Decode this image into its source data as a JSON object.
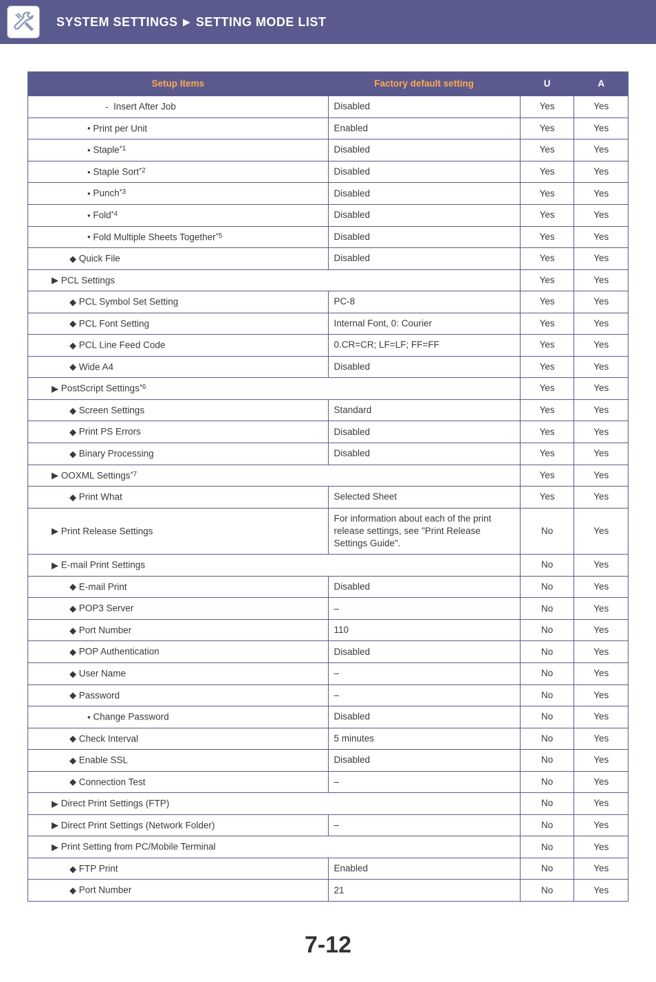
{
  "header": {
    "title_left": "SYSTEM SETTINGS",
    "title_right": "SETTING MODE LIST"
  },
  "columns": {
    "setup": "Setup Items",
    "factory": "Factory default setting",
    "u": "U",
    "a": "A"
  },
  "rows": [
    {
      "indent": 4,
      "marker": "dash",
      "label": "Insert After Job",
      "factory": "Disabled",
      "u": "Yes",
      "a": "Yes"
    },
    {
      "indent": 3,
      "marker": "bullet",
      "label": "Print per Unit",
      "factory": "Enabled",
      "u": "Yes",
      "a": "Yes"
    },
    {
      "indent": 3,
      "marker": "bullet",
      "label": "Staple",
      "sup": "*1",
      "factory": "Disabled",
      "u": "Yes",
      "a": "Yes"
    },
    {
      "indent": 3,
      "marker": "bullet",
      "label": "Staple Sort",
      "sup": "*2",
      "factory": "Disabled",
      "u": "Yes",
      "a": "Yes"
    },
    {
      "indent": 3,
      "marker": "bullet",
      "label": "Punch",
      "sup": "*3",
      "factory": "Disabled",
      "u": "Yes",
      "a": "Yes"
    },
    {
      "indent": 3,
      "marker": "bullet",
      "label": "Fold",
      "sup": "*4",
      "factory": "Disabled",
      "u": "Yes",
      "a": "Yes"
    },
    {
      "indent": 3,
      "marker": "bullet",
      "label": "Fold Multiple Sheets Together",
      "sup": "*5",
      "factory": "Disabled",
      "u": "Yes",
      "a": "Yes"
    },
    {
      "indent": 2,
      "marker": "diamond",
      "label": "Quick File",
      "factory": "Disabled",
      "u": "Yes",
      "a": "Yes"
    },
    {
      "indent": 1,
      "marker": "tri",
      "label": "PCL Settings",
      "factory": "",
      "span": true,
      "u": "Yes",
      "a": "Yes"
    },
    {
      "indent": 2,
      "marker": "diamond",
      "label": "PCL Symbol Set Setting",
      "factory": "PC-8",
      "u": "Yes",
      "a": "Yes"
    },
    {
      "indent": 2,
      "marker": "diamond",
      "label": "PCL Font Setting",
      "factory": "Internal Font, 0: Courier",
      "u": "Yes",
      "a": "Yes"
    },
    {
      "indent": 2,
      "marker": "diamond",
      "label": "PCL Line Feed Code",
      "factory": "0.CR=CR; LF=LF; FF=FF",
      "u": "Yes",
      "a": "Yes"
    },
    {
      "indent": 2,
      "marker": "diamond",
      "label": "Wide A4",
      "factory": "Disabled",
      "u": "Yes",
      "a": "Yes"
    },
    {
      "indent": 1,
      "marker": "tri",
      "label": "PostScript Settings",
      "sup": "*6",
      "factory": "",
      "span": true,
      "u": "Yes",
      "a": "Yes"
    },
    {
      "indent": 2,
      "marker": "diamond",
      "label": "Screen Settings",
      "factory": "Standard",
      "u": "Yes",
      "a": "Yes"
    },
    {
      "indent": 2,
      "marker": "diamond",
      "label": "Print PS Errors",
      "factory": "Disabled",
      "u": "Yes",
      "a": "Yes"
    },
    {
      "indent": 2,
      "marker": "diamond",
      "label": "Binary Processing",
      "factory": "Disabled",
      "u": "Yes",
      "a": "Yes"
    },
    {
      "indent": 1,
      "marker": "tri",
      "label": "OOXML Settings",
      "sup": "*7",
      "factory": "",
      "span": true,
      "u": "Yes",
      "a": "Yes"
    },
    {
      "indent": 2,
      "marker": "diamond",
      "label": "Print What",
      "factory": "Selected Sheet",
      "u": "Yes",
      "a": "Yes"
    },
    {
      "indent": 1,
      "marker": "tri",
      "label": "Print Release Settings",
      "factory": "For information about each of the print release settings, see \"Print Release Settings Guide\".",
      "u": "No",
      "a": "Yes"
    },
    {
      "indent": 1,
      "marker": "tri",
      "label": "E-mail Print Settings",
      "factory": "",
      "span": true,
      "u": "No",
      "a": "Yes"
    },
    {
      "indent": 2,
      "marker": "diamond",
      "label": "E-mail Print",
      "factory": "Disabled",
      "u": "No",
      "a": "Yes"
    },
    {
      "indent": 2,
      "marker": "diamond",
      "label": "POP3 Server",
      "factory": "–",
      "u": "No",
      "a": "Yes"
    },
    {
      "indent": 2,
      "marker": "diamond",
      "label": "Port Number",
      "factory": "110",
      "u": "No",
      "a": "Yes"
    },
    {
      "indent": 2,
      "marker": "diamond",
      "label": "POP Authentication",
      "factory": "Disabled",
      "u": "No",
      "a": "Yes"
    },
    {
      "indent": 2,
      "marker": "diamond",
      "label": "User Name",
      "factory": "–",
      "u": "No",
      "a": "Yes"
    },
    {
      "indent": 2,
      "marker": "diamond",
      "label": "Password",
      "factory": "–",
      "u": "No",
      "a": "Yes"
    },
    {
      "indent": 3,
      "marker": "bullet",
      "label": "Change Password",
      "factory": "Disabled",
      "u": "No",
      "a": "Yes"
    },
    {
      "indent": 2,
      "marker": "diamond",
      "label": "Check Interval",
      "factory": "5 minutes",
      "u": "No",
      "a": "Yes"
    },
    {
      "indent": 2,
      "marker": "diamond",
      "label": "Enable SSL",
      "factory": "Disabled",
      "u": "No",
      "a": "Yes"
    },
    {
      "indent": 2,
      "marker": "diamond",
      "label": "Connection Test",
      "factory": "–",
      "u": "No",
      "a": "Yes"
    },
    {
      "indent": 1,
      "marker": "tri",
      "label": "Direct Print Settings (FTP)",
      "factory": "",
      "span": true,
      "u": "No",
      "a": "Yes"
    },
    {
      "indent": 1,
      "marker": "tri",
      "label": "Direct Print Settings (Network Folder)",
      "factory": "–",
      "u": "No",
      "a": "Yes"
    },
    {
      "indent": 1,
      "marker": "tri",
      "label": "Print Setting from PC/Mobile Terminal",
      "factory": "",
      "span": true,
      "u": "No",
      "a": "Yes"
    },
    {
      "indent": 2,
      "marker": "diamond",
      "label": "FTP Print",
      "factory": "Enabled",
      "u": "No",
      "a": "Yes"
    },
    {
      "indent": 2,
      "marker": "diamond",
      "label": "Port Number",
      "factory": "21",
      "u": "No",
      "a": "Yes"
    }
  ],
  "page_number": "7-12"
}
